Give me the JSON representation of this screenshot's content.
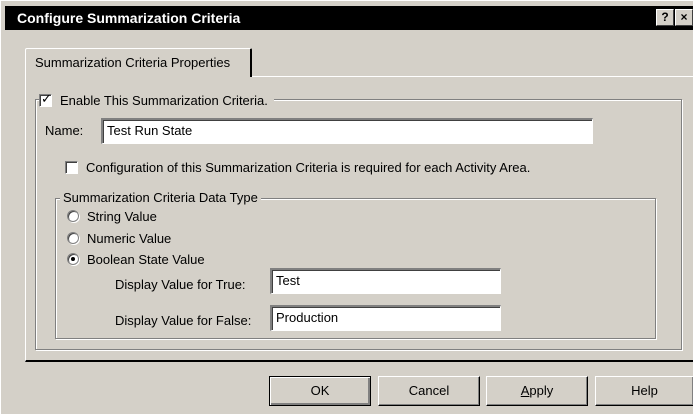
{
  "window": {
    "title": "Configure Summarization Criteria",
    "help_button": "?",
    "close_button": "×"
  },
  "tabs": [
    {
      "label": "Summarization Criteria Properties",
      "selected": true
    }
  ],
  "enable_checkbox": {
    "label": "Enable This Summarization Criteria.",
    "checked": true
  },
  "name_field": {
    "label": "Name:",
    "value": "Test Run State"
  },
  "required_checkbox": {
    "label": "Configuration of this Summarization Criteria is required for each Activity Area.",
    "checked": false
  },
  "data_type_group": {
    "legend": "Summarization Criteria Data Type",
    "options": [
      {
        "label": "String Value",
        "selected": false
      },
      {
        "label": "Numeric Value",
        "selected": false
      },
      {
        "label": "Boolean State Value",
        "selected": true
      }
    ],
    "true_field": {
      "label": "Display Value for True:",
      "value": "Test"
    },
    "false_field": {
      "label": "Display Value for False:",
      "value": "Production"
    }
  },
  "buttons": {
    "ok": "OK",
    "cancel": "Cancel",
    "apply_prefix": "A",
    "apply_rest": "pply",
    "help": "Help"
  },
  "colors": {
    "dialog_face": "#d4d0c8",
    "titlebar": "#000000"
  }
}
